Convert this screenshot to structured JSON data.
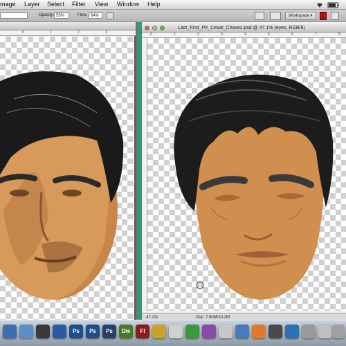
{
  "menubar": {
    "items": [
      "mage",
      "Layer",
      "Select",
      "Filter",
      "View",
      "Window",
      "Help"
    ]
  },
  "options": {
    "opacity_label": "Opacity:",
    "opacity_value": "55%",
    "flow_label": "Flow:",
    "flow_value": "64%",
    "workspace_label": "Workspace ▾"
  },
  "left_doc": {
    "ruler_marks": [
      "0",
      "1",
      "2",
      "3"
    ]
  },
  "right_doc": {
    "title": "Last_First_P#_Cesar_Chavez.psd @ 47.1% (eyes, RGB/8)",
    "ruler_marks": [
      "0",
      "1",
      "2",
      "3",
      "4",
      "5",
      "6",
      "7",
      "8"
    ],
    "zoom": "47.1%",
    "doc_info": "Doc: 7.90M/10.2M"
  },
  "dock": {
    "apps": [
      {
        "label": "Ps",
        "color": "#1d4e8c"
      },
      {
        "label": "Ps",
        "color": "#1d4e8c"
      },
      {
        "label": "Ps",
        "color": "#2a3f66"
      },
      {
        "label": "Dw",
        "color": "#4a7a24"
      },
      {
        "label": "Fl",
        "color": "#8b1c1c"
      }
    ]
  },
  "colors": {
    "skin": "#cf8f4f",
    "hair": "#1c1c1c"
  }
}
